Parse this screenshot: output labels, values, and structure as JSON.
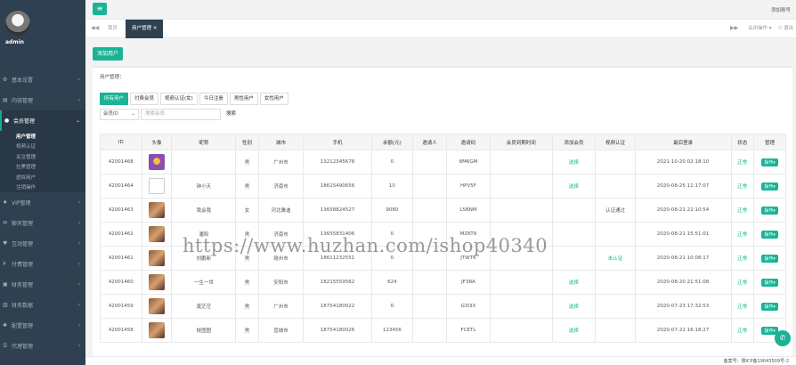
{
  "sidebar": {
    "username": "admin",
    "items": [
      {
        "icon": "gear-icon",
        "label": "基本设置",
        "expanded": false
      },
      {
        "icon": "document-icon",
        "label": "内容管理",
        "expanded": false
      },
      {
        "icon": "user-icon",
        "label": "会员管理",
        "expanded": true
      },
      {
        "icon": "vip-icon",
        "label": "VIP管理",
        "expanded": false
      },
      {
        "icon": "chat-icon",
        "label": "聊天管理",
        "expanded": false
      },
      {
        "icon": "heart-icon",
        "label": "互动管理",
        "expanded": false
      },
      {
        "icon": "money-icon",
        "label": "付费管理",
        "expanded": false
      },
      {
        "icon": "wallet-icon",
        "label": "财务管理",
        "expanded": false
      },
      {
        "icon": "chart-icon",
        "label": "财务数据",
        "expanded": false
      },
      {
        "icon": "config-icon",
        "label": "配置管理",
        "expanded": false
      },
      {
        "icon": "agent-icon",
        "label": "代理管理",
        "expanded": false
      }
    ],
    "subitems": [
      "用户管理",
      "视频认证",
      "关注管理",
      "拉黑管理",
      "虚拟用户",
      "注销操作"
    ]
  },
  "topbar": {
    "menu_icon": "≡",
    "welcome": "添加账号"
  },
  "tabs": {
    "items": [
      "首页",
      "用户管理"
    ],
    "right_ops": "关闭操作",
    "logout": "退出"
  },
  "toolbar": {
    "add_label": "添加用户"
  },
  "list": {
    "title": "用户管理：",
    "filters": [
      "所有用户",
      "付费会员",
      "视频认证(女)",
      "今日注册",
      "男性用户",
      "女性用户"
    ],
    "search_select": "会员ID",
    "search_placeholder": "搜索会员",
    "search_button": "搜索",
    "columns": [
      "ID",
      "头像",
      "昵称",
      "性别",
      "城市",
      "手机",
      "余额(元)",
      "邀请人",
      "邀请码",
      "会员到期时间",
      "添加会员",
      "视频认证",
      "最后登录",
      "状态",
      "管理"
    ],
    "rows": [
      {
        "id": "42001468",
        "avatar": "purple",
        "nick": "",
        "gender": "男",
        "city": "广州市",
        "phone": "13212345678",
        "balance": "0",
        "inviter": "",
        "code": "8M6GM",
        "expire": "",
        "add": "选择",
        "video": "",
        "login": "2021-10-20 02:18:10",
        "status": "正常",
        "manage": "操作▾"
      },
      {
        "id": "42001464",
        "avatar": "blank",
        "nick": "钟小天",
        "gender": "男",
        "city": "济南市",
        "phone": "18615490656",
        "balance": "10",
        "inviter": "",
        "code": "HPV5F",
        "expire": "",
        "add": "选择",
        "video": "",
        "login": "2020-08-25 11:17:07",
        "status": "正常",
        "manage": "操作▾"
      },
      {
        "id": "42001463",
        "avatar": "photo",
        "nick": "我会我",
        "gender": "女",
        "city": "河北雅迪",
        "phone": "13658824527",
        "balance": "9080",
        "inviter": "",
        "code": "L5BNM",
        "expire": "",
        "add": "",
        "video": "认证通过",
        "login": "2020-08-21 22:10:54",
        "status": "正常",
        "manage": "操作▾"
      },
      {
        "id": "42001462",
        "avatar": "photo",
        "nick": "潘阳",
        "gender": "男",
        "city": "济南市",
        "phone": "13655831406",
        "balance": "0",
        "inviter": "",
        "code": "MZKT9",
        "expire": "",
        "add": "",
        "video": "",
        "login": "2020-08-21 15:51:01",
        "status": "正常",
        "manage": "操作▾"
      },
      {
        "id": "42001461",
        "avatar": "photo",
        "nick": "刘鹏新",
        "gender": "男",
        "city": "赣州市",
        "phone": "18611232551",
        "balance": "0",
        "inviter": "",
        "code": "JTWTK",
        "expire": "",
        "add": "",
        "video": "未认证",
        "login": "2020-08-21 10:08:17",
        "status": "正常",
        "manage": "操作▾"
      },
      {
        "id": "42001460",
        "avatar": "photo",
        "nick": "一生一世",
        "gender": "男",
        "city": "安阳市",
        "phone": "18215559562",
        "balance": "624",
        "inviter": "",
        "code": "JF3RA",
        "expire": "",
        "add": "选择",
        "video": "",
        "login": "2020-08-20 21:51:08",
        "status": "正常",
        "manage": "操作▾"
      },
      {
        "id": "42001459",
        "avatar": "photo",
        "nick": "寞茫茫",
        "gender": "男",
        "city": "广州市",
        "phone": "18754180022",
        "balance": "0",
        "inviter": "",
        "code": "G3I3X",
        "expire": "",
        "add": "选择",
        "video": "",
        "login": "2020-07-23 17:32:53",
        "status": "正常",
        "manage": "操作▾"
      },
      {
        "id": "42001458",
        "avatar": "photo",
        "nick": "枝图图",
        "gender": "男",
        "city": "宣城市",
        "phone": "18754180026",
        "balance": "123456",
        "inviter": "",
        "code": "FCETL",
        "expire": "",
        "add": "选择",
        "video": "",
        "login": "2020-07-22 16:18:27",
        "status": "正常",
        "manage": "操作▾"
      }
    ]
  },
  "watermark": "https://www.huzhan.com/ishop40340",
  "footer": {
    "icp": "备案号：豫ICP备19043509号-2"
  },
  "colors": {
    "accent": "#1ab394",
    "sidebar": "#2f4050"
  }
}
